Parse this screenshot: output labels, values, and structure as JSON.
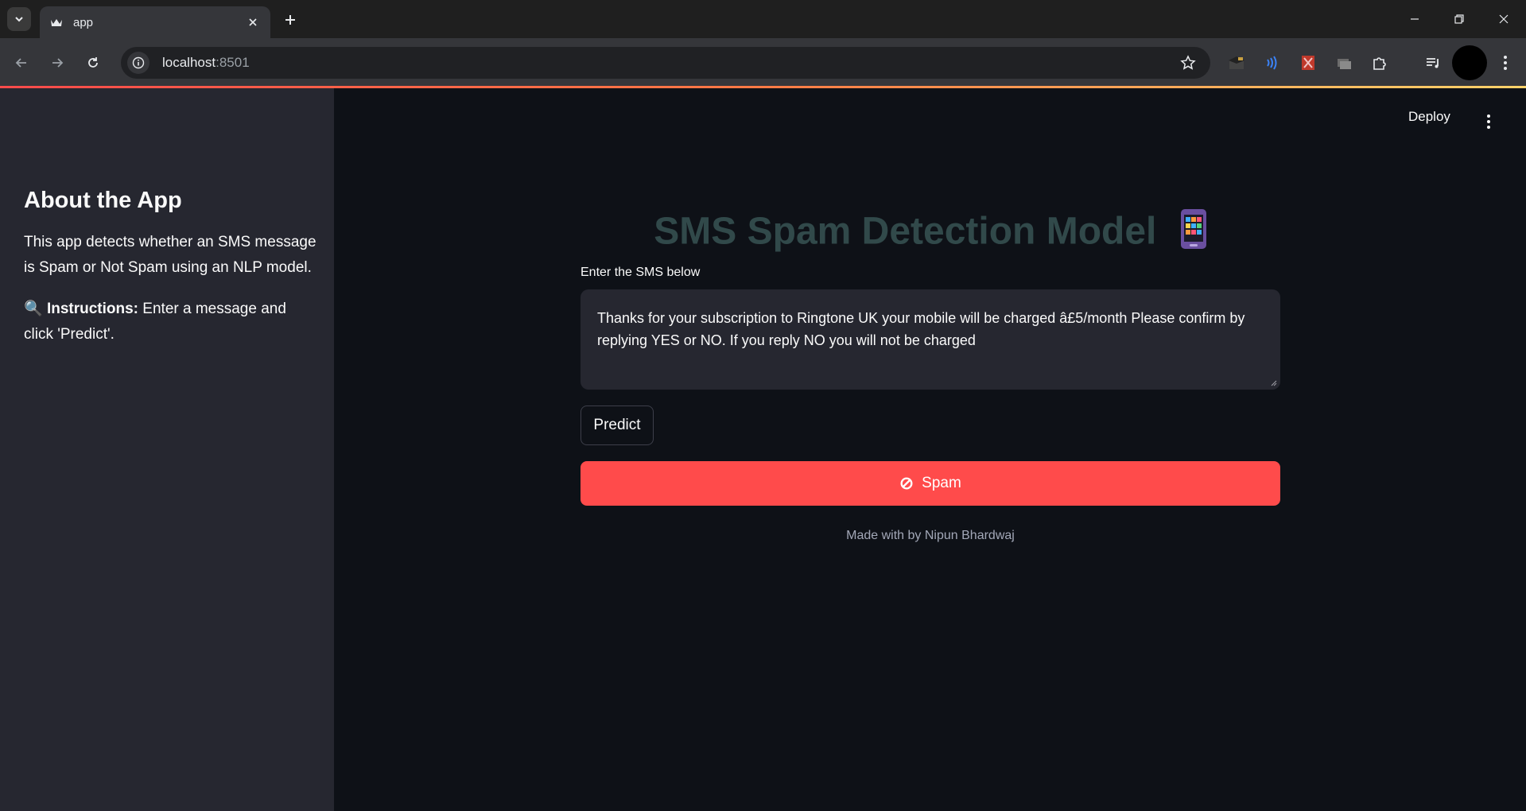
{
  "browser": {
    "tab_title": "app",
    "url_host": "localhost",
    "url_port": ":8501"
  },
  "sidebar": {
    "heading": "About the App",
    "description": "This app detects whether an SMS message is Spam or Not Spam using an NLP model.",
    "instructions_icon": "🔍",
    "instructions_label": "Instructions:",
    "instructions_text": " Enter a message and click 'Predict'."
  },
  "header": {
    "deploy_label": "Deploy"
  },
  "main": {
    "title": "SMS Spam Detection Model",
    "title_icon": "mobile-phone-icon",
    "input_label": "Enter the SMS below",
    "input_value": "Thanks for your subscription to Ringtone UK your mobile will be charged â£5/month Please confirm by replying YES or NO. If you reply NO you will not be charged",
    "predict_label": "Predict",
    "result_label": "Spam",
    "result_color": "#ff4b4b",
    "footer": "Made with by Nipun Bhardwaj"
  },
  "colors": {
    "background": "#0e1117",
    "sidebar": "#262730",
    "title": "#31494a"
  }
}
